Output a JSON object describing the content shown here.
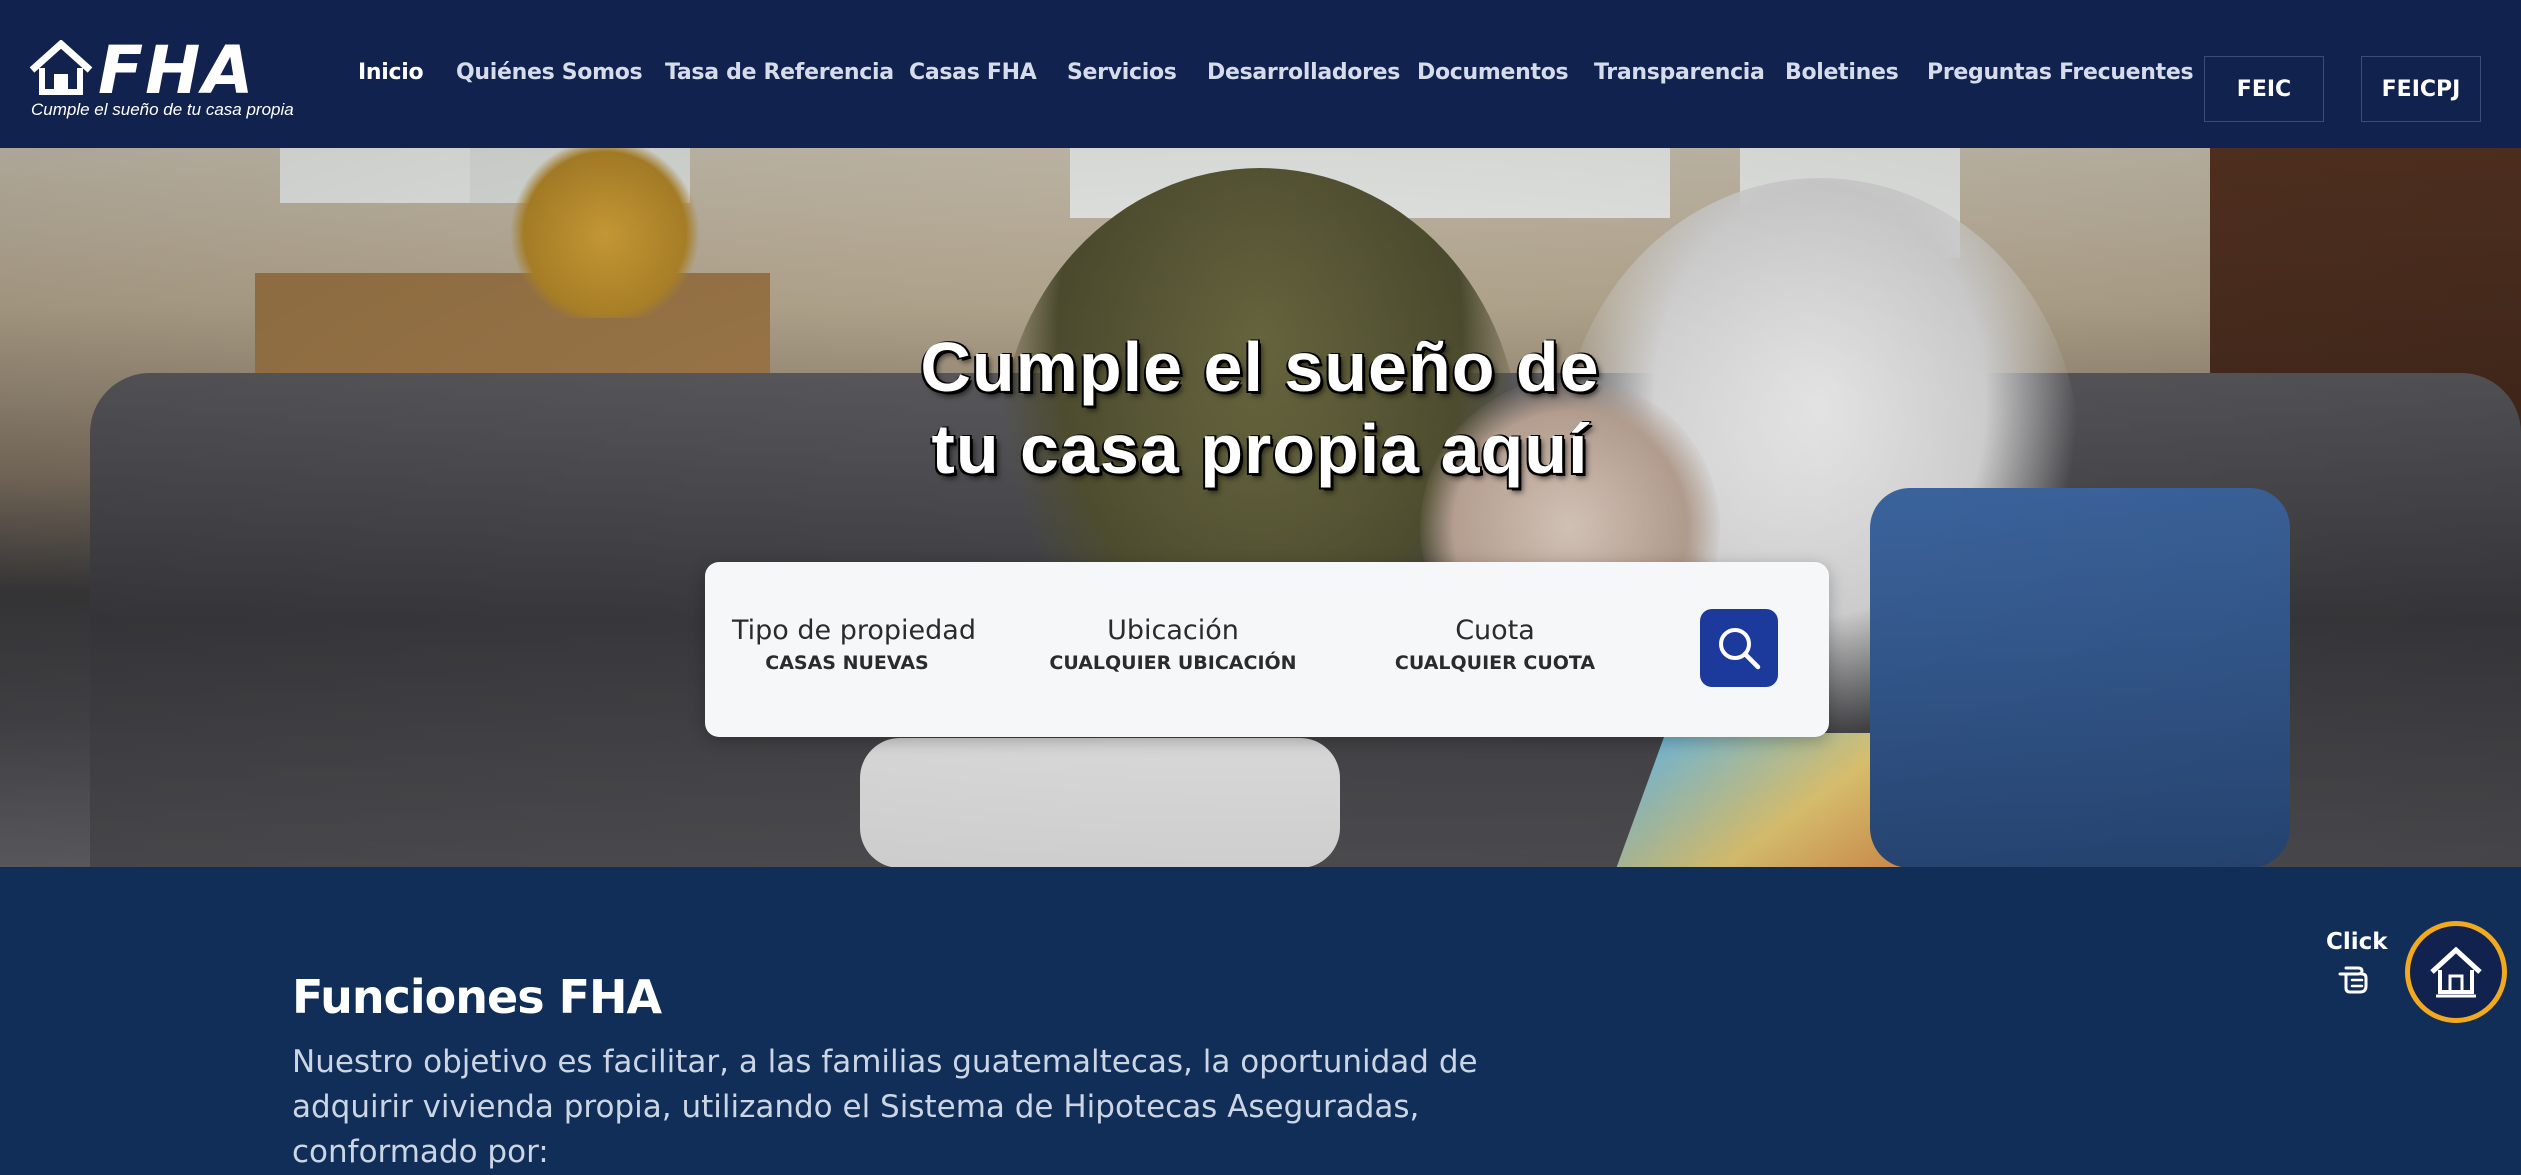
{
  "nav": {
    "logo": {
      "text": "FHA",
      "tagline": "Cumple el sueño de tu casa propia",
      "icon": "house-icon"
    },
    "items": [
      {
        "label": "Inicio",
        "active": true
      },
      {
        "label": "Quiénes Somos"
      },
      {
        "label": "Tasa de Referencia"
      },
      {
        "label": "Casas FHA"
      },
      {
        "label": "Servicios"
      },
      {
        "label": "Desarrolladores"
      },
      {
        "label": "Documentos"
      },
      {
        "label": "Transparencia"
      },
      {
        "label": "Boletines"
      },
      {
        "label": "Preguntas Frecuentes"
      }
    ],
    "buttons": [
      "FEIC",
      "FEICPJ"
    ]
  },
  "hero": {
    "title_line1": "Cumple el sueño de",
    "title_line2": "tu casa propia aquí",
    "search": {
      "fields": [
        {
          "label": "Tipo de propiedad",
          "value": "CASAS NUEVAS"
        },
        {
          "label": "Ubicación",
          "value": "CUALQUIER UBICACIÓN"
        },
        {
          "label": "Cuota",
          "value": "CUALQUIER CUOTA"
        }
      ],
      "button_icon": "search-icon"
    }
  },
  "funciones": {
    "title": "Funciones FHA",
    "description": "Nuestro objetivo es facilitar, a las familias guatemaltecas, la oportunidad de adquirir vivienda propia, utilizando el Sistema de Hipotecas Aseguradas, conformado por:"
  },
  "floating": {
    "click_label": "Click",
    "hand_icon": "pointing-hand-icon",
    "home_icon": "house-icon"
  },
  "colors": {
    "nav_bg": "#11224f",
    "section_bg": "#102e57",
    "search_btn": "#1c3a9b",
    "ring": "#f2a91e"
  }
}
